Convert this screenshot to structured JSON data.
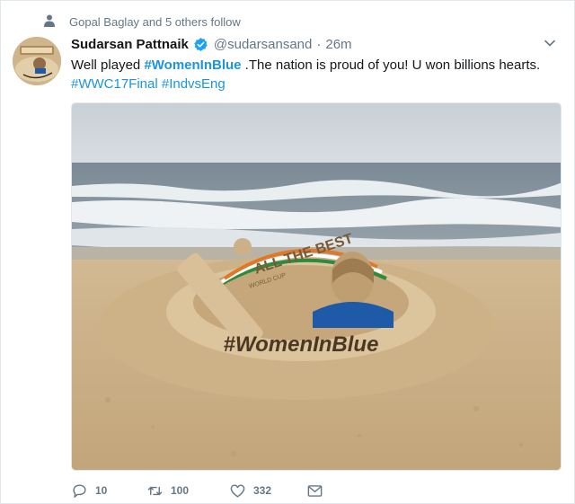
{
  "context": {
    "text": "Gopal Baglay and 5 others follow",
    "icon": "person-icon"
  },
  "tweet": {
    "author_name": "Sudarsan Pattnaik",
    "handle": "@sudarsansand",
    "separator": "·",
    "time": "26m",
    "verified_icon": "verified-badge-icon",
    "text_parts": {
      "pre": "Well played ",
      "hashtag1": "#WomenInBlue",
      "mid": " .The nation is proud of you! U won billions hearts.",
      "hashtag2": "#WWC17Final",
      "space": " ",
      "hashtag3": "#IndvsEng"
    },
    "image": {
      "sculpture_caption": "#WomenInBlue",
      "bat_text": "ALL THE BEST",
      "bat_small_text": "WORLD CUP"
    }
  },
  "actions": {
    "reply_count": "10",
    "retweet_count": "100",
    "like_count": "332"
  },
  "colors": {
    "link": "#1b95e0",
    "muted": "#657786",
    "verified": "#1da1f2"
  }
}
